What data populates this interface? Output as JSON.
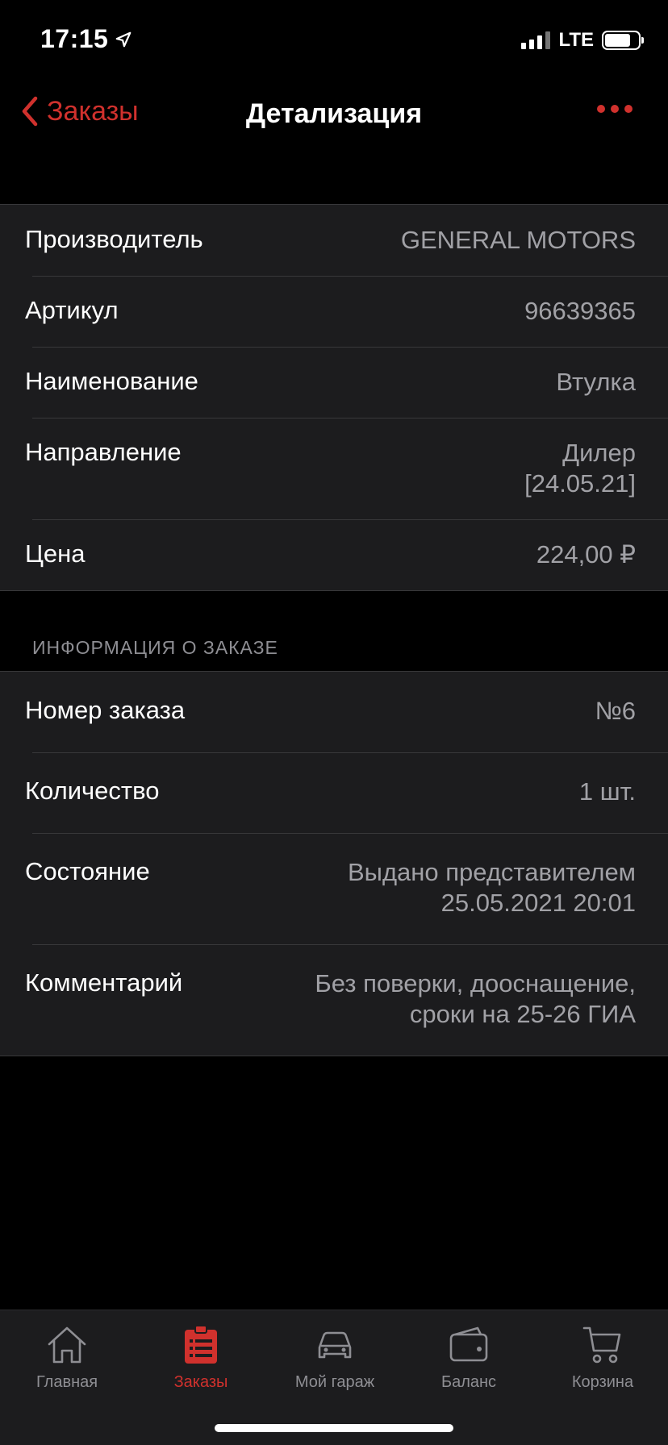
{
  "status_bar": {
    "time": "17:15",
    "network": "LTE"
  },
  "nav": {
    "back_label": "Заказы",
    "title": "Детализация"
  },
  "details": [
    {
      "label": "Производитель",
      "value": "GENERAL MOTORS"
    },
    {
      "label": "Артикул",
      "value": "96639365"
    },
    {
      "label": "Наименование",
      "value": "Втулка"
    },
    {
      "label": "Направление",
      "value": "Дилер\n[24.05.21]"
    },
    {
      "label": "Цена",
      "value": "224,00 ₽"
    }
  ],
  "order_section": {
    "header": "ИНФОРМАЦИЯ О ЗАКАЗЕ",
    "rows": [
      {
        "label": "Номер заказа",
        "value": "№6"
      },
      {
        "label": "Количество",
        "value": "1 шт."
      },
      {
        "label": "Состояние",
        "value": "Выдано представителем\n25.05.2021 20:01"
      },
      {
        "label": "Комментарий",
        "value": "Без поверки, дооснащение,\nсроки на 25-26 ГИА"
      }
    ]
  },
  "tab_bar": {
    "tabs": [
      {
        "label": "Главная",
        "icon": "home-icon",
        "active": false
      },
      {
        "label": "Заказы",
        "icon": "orders-icon",
        "active": true
      },
      {
        "label": "Мой гараж",
        "icon": "car-icon",
        "active": false
      },
      {
        "label": "Баланс",
        "icon": "wallet-icon",
        "active": false
      },
      {
        "label": "Корзина",
        "icon": "cart-icon",
        "active": false
      }
    ]
  },
  "colors": {
    "accent": "#d0312d",
    "background": "#000000",
    "cell": "#1c1c1e",
    "secondary_text": "#a1a1a6"
  }
}
